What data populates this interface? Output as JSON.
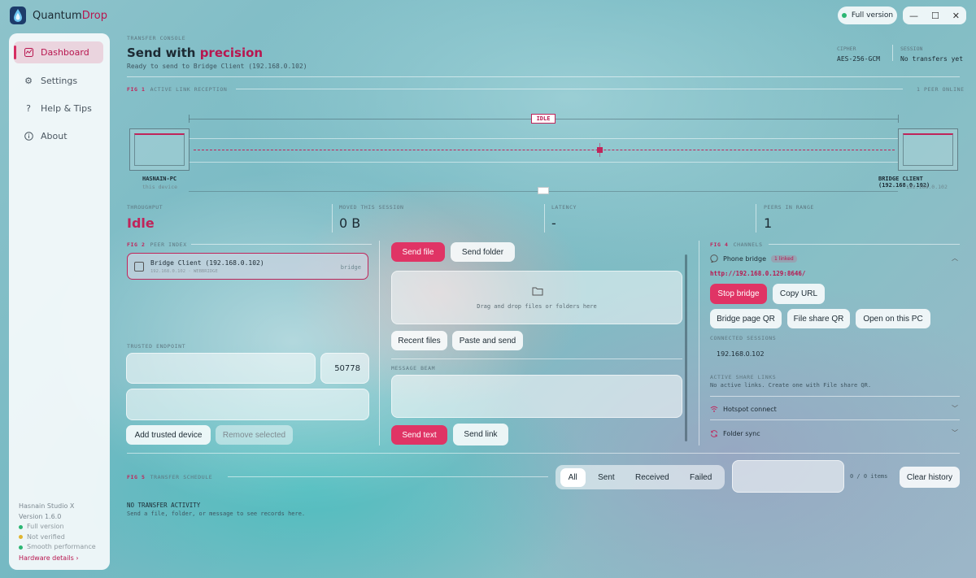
{
  "app": {
    "name_part1": "Quantum",
    "name_part2": "Drop"
  },
  "titlebar": {
    "full_version": "Full version",
    "minimize": "—",
    "maximize": "☐",
    "close": "✕"
  },
  "sidebar": {
    "items": [
      {
        "label": "Dashboard",
        "icon": "dashboard-icon",
        "active": true
      },
      {
        "label": "Settings",
        "icon": "gear-icon"
      },
      {
        "label": "Help & Tips",
        "icon": "question-icon"
      },
      {
        "label": "About",
        "icon": "info-icon"
      }
    ],
    "footer": {
      "studio": "Hasnain Studio X",
      "version": "Version 1.6.0",
      "status": [
        {
          "label": "Full version",
          "color": "#2bb673"
        },
        {
          "label": "Not verified",
          "color": "#e0b530"
        },
        {
          "label": "Smooth performance",
          "color": "#2bb673"
        }
      ],
      "hardware_link": "Hardware details ›"
    }
  },
  "header": {
    "eyebrow": "TRANSFER CONSOLE",
    "title_part1": "Send with ",
    "title_part2": "precision",
    "subtitle": "Ready to send to Bridge Client (192.168.0.102)",
    "cipher_label": "CIPHER",
    "cipher_value": "AES-256-GCM",
    "session_label": "SESSION",
    "session_value": "No transfers yet"
  },
  "link_viz": {
    "fig": "FIG 1",
    "title": "ACTIVE LINK RECEPTION",
    "peers_online": "1 PEER ONLINE",
    "state": "IDLE",
    "local_name": "HASNAIN-PC",
    "local_sub": "this device",
    "remote_name": "BRIDGE CLIENT (192.168.0.102)",
    "remote_sub": "192.168.0.102"
  },
  "stats": [
    {
      "label": "THROUGHPUT",
      "value": "Idle"
    },
    {
      "label": "MOVED THIS SESSION",
      "value": "0 B"
    },
    {
      "label": "LATENCY",
      "value": "-"
    },
    {
      "label": "PEERS IN RANGE",
      "value": "1"
    }
  ],
  "peer_index": {
    "fig": "FIG 2",
    "title": "PEER INDEX",
    "peer_name": "Bridge Client (192.168.0.102)",
    "peer_sub": "192.168.0.102 · WEBBRIDGE",
    "peer_tag": "bridge"
  },
  "trusted": {
    "label": "TRUSTED ENDPOINT",
    "port_value": "50778",
    "add_button": "Add trusted device",
    "remove_button": "Remove selected"
  },
  "send": {
    "send_file": "Send file",
    "send_folder": "Send folder",
    "drop_text": "Drag and drop files or folders here",
    "recent_files": "Recent files",
    "paste_send": "Paste and send",
    "message_label": "MESSAGE BEAM",
    "send_text": "Send text",
    "send_link": "Send link"
  },
  "channels": {
    "fig": "FIG 4",
    "title": "CHANNELS",
    "phone_bridge": "Phone bridge",
    "linked_badge": "1 linked",
    "url": "http://192.168.0.129:8646/",
    "stop_bridge": "Stop bridge",
    "copy_url": "Copy URL",
    "bridge_qr": "Bridge page QR",
    "file_share_qr": "File share QR",
    "open_pc": "Open on this PC",
    "connected_label": "CONNECTED SESSIONS",
    "connected_ip": "192.168.0.102",
    "share_links_label": "ACTIVE SHARE LINKS",
    "share_links_text": "No active links. Create one with File share QR.",
    "hotspot": "Hotspot connect",
    "folder_sync": "Folder sync"
  },
  "history": {
    "fig": "FIG 5",
    "title": "TRANSFER SCHEDULE",
    "tabs": [
      "All",
      "Sent",
      "Received",
      "Failed"
    ],
    "count": "0 / 0 items",
    "clear": "Clear history",
    "empty_title": "NO TRANSFER ACTIVITY",
    "empty_sub": "Send a file, folder, or message to see records here."
  },
  "colors": {
    "accent": "#c0245a",
    "accent_button": "#e03465"
  }
}
